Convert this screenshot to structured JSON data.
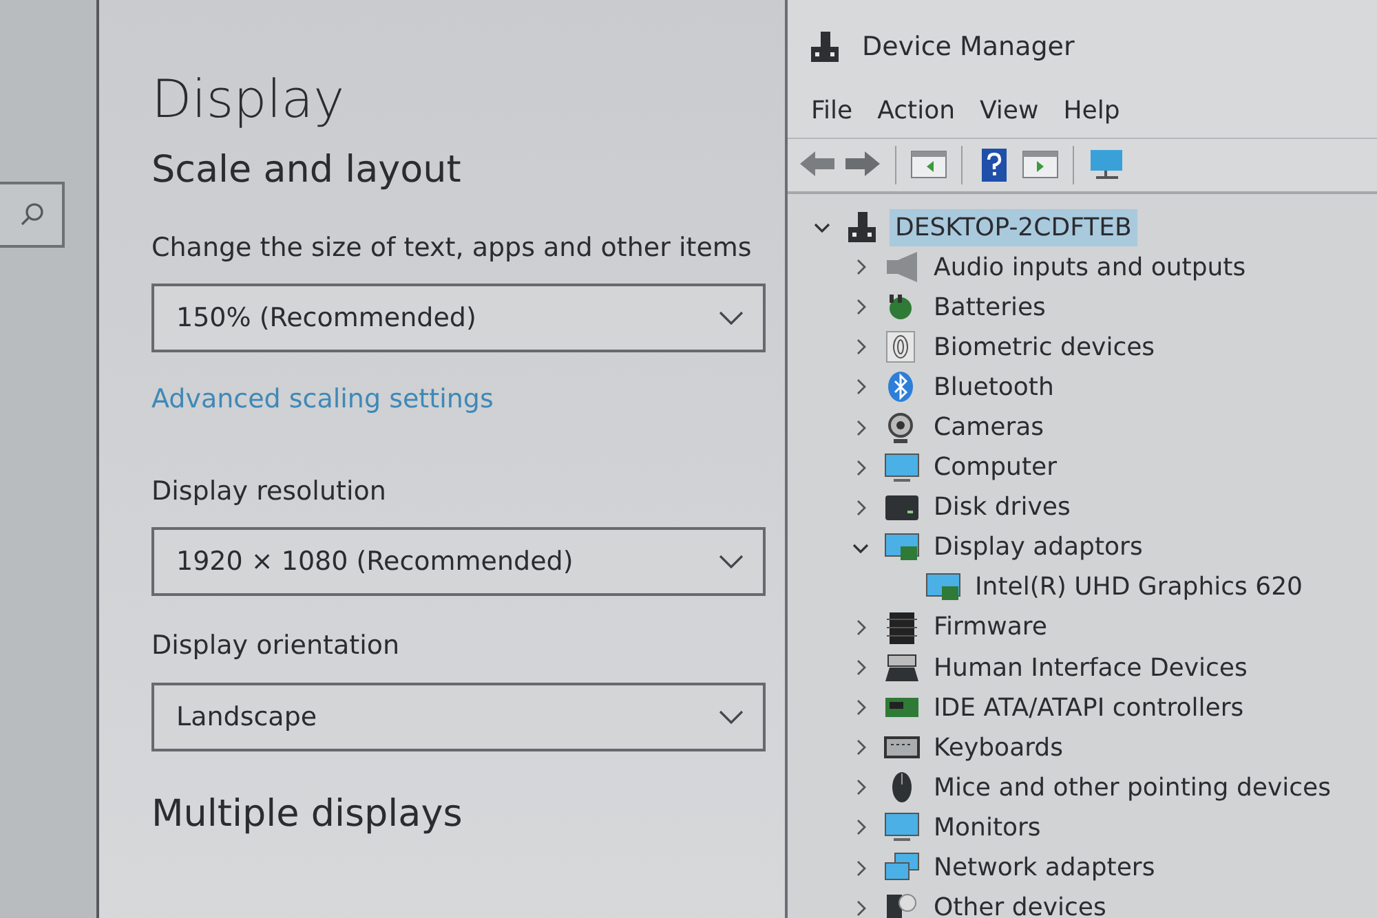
{
  "settings": {
    "title": "Display",
    "section": "Scale and layout",
    "fields": [
      {
        "label": "Change the size of text, apps and other items",
        "value": "150% (Recommended)"
      },
      {
        "link": "Advanced scaling settings"
      },
      {
        "label": "Display resolution",
        "value": "1920 × 1080 (Recommended)"
      },
      {
        "label": "Display orientation",
        "value": "Landscape"
      }
    ],
    "next_section": "Multiple displays"
  },
  "device_manager": {
    "window": {
      "title": "Device Manager"
    },
    "menu": [
      "File",
      "Action",
      "View",
      "Help"
    ],
    "tree": {
      "label": "DESKTOP-2CDFTEB",
      "expanded": true,
      "selected": true,
      "children": [
        {
          "label": "Audio inputs and outputs",
          "expanded": false,
          "selected": false
        },
        {
          "label": "Batteries",
          "expanded": false,
          "selected": false
        },
        {
          "label": "Biometric devices",
          "expanded": false,
          "selected": false
        },
        {
          "label": "Bluetooth",
          "expanded": false,
          "selected": false
        },
        {
          "label": "Cameras",
          "expanded": false,
          "selected": false
        },
        {
          "label": "Computer",
          "expanded": false,
          "selected": false
        },
        {
          "label": "Disk drives",
          "expanded": false,
          "selected": false
        },
        {
          "label": "Display adaptors",
          "expanded": true,
          "selected": false,
          "children": [
            {
              "label": "Intel(R) UHD Graphics 620",
              "selected": false
            }
          ]
        },
        {
          "label": "Firmware",
          "expanded": false,
          "selected": false
        },
        {
          "label": "Human Interface Devices",
          "expanded": false,
          "selected": false
        },
        {
          "label": "IDE ATA/ATAPI controllers",
          "expanded": false,
          "selected": false
        },
        {
          "label": "Keyboards",
          "expanded": false,
          "selected": false
        },
        {
          "label": "Mice and other pointing devices",
          "expanded": false,
          "selected": false
        },
        {
          "label": "Monitors",
          "expanded": false,
          "selected": false
        },
        {
          "label": "Network adapters",
          "expanded": false,
          "selected": false
        },
        {
          "label": "Other devices",
          "expanded": false,
          "selected": false
        }
      ]
    }
  }
}
